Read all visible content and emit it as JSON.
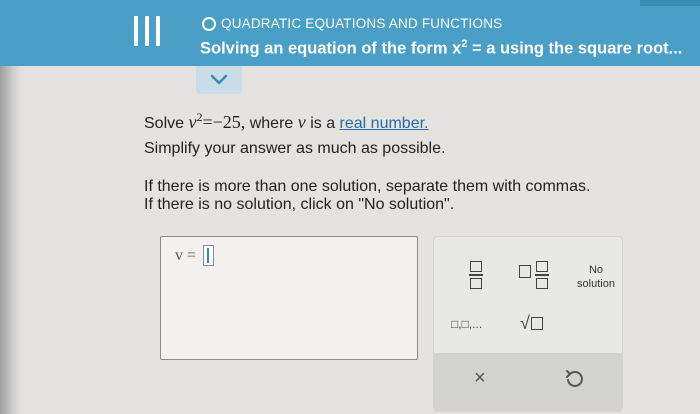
{
  "header": {
    "topic": "QUADRATIC EQUATIONS AND FUNCTIONS",
    "title_prefix": "Solving an equation of the form x",
    "title_exponent": "2",
    "title_suffix": " = a using the square root..."
  },
  "question": {
    "solve_word": "Solve ",
    "var": "v",
    "exponent": "2",
    "equation_rest": "=−25,",
    "where_text": " where ",
    "var2": "v",
    "is_a": " is a ",
    "link_text": "real number.",
    "simplify": "Simplify your answer as much as possible.",
    "instr1": "If there is more than one solution, separate them with commas.",
    "instr2": "If there is no solution, click on \"No solution\"."
  },
  "answer": {
    "label": "v ="
  },
  "tools": {
    "no_solution_line1": "No",
    "no_solution_line2": "solution",
    "list_label": "□,□,...",
    "sqrt_symbol": "√",
    "clear_symbol": "×"
  },
  "colors": {
    "header": "#4a9fc7",
    "link": "#2a6aa8",
    "cursor": "#3a7fd5"
  }
}
